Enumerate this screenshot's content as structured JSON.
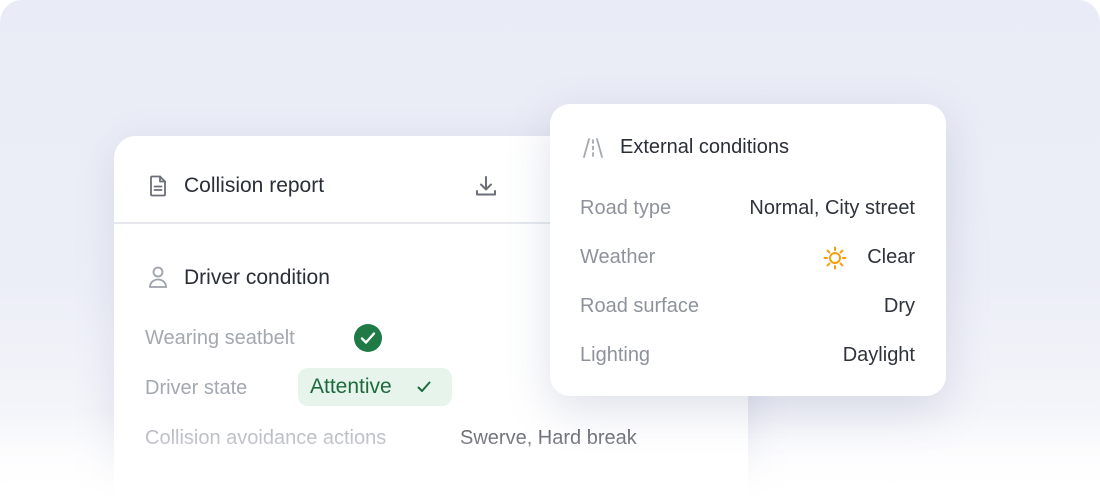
{
  "report": {
    "title": "Collision report",
    "download_icon": "download-icon",
    "doc_icon": "document-icon",
    "driver": {
      "heading": "Driver condition",
      "icon": "person-icon",
      "seatbelt_label": "Wearing seatbelt",
      "seatbelt_value_icon": "check-circle-icon",
      "state_label": "Driver state",
      "state_value": "Attentive",
      "avoidance_label": "Collision avoidance actions",
      "avoidance_value": "Swerve, Hard break"
    }
  },
  "external": {
    "title": "External conditions",
    "icon": "road-icon",
    "rows": [
      {
        "label": "Road type",
        "value": "Normal, City street"
      },
      {
        "label": "Weather",
        "value": "Clear",
        "icon": "sun-icon"
      },
      {
        "label": "Road surface",
        "value": "Dry"
      },
      {
        "label": "Lighting",
        "value": "Daylight"
      }
    ]
  },
  "colors": {
    "background": "#e9ecf6",
    "success_green": "#1f7a45",
    "badge_bg": "#e6f4ec",
    "sun_orange": "#f59e0b"
  }
}
